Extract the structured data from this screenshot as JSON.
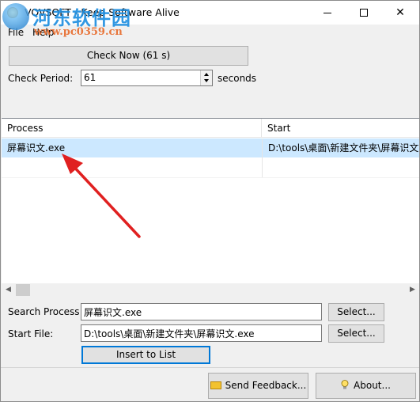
{
  "window": {
    "title": "VOVSOFT - Keep Software Alive",
    "controls": [
      "minimize",
      "maximize",
      "close"
    ]
  },
  "watermark": {
    "site_name": "河东软件园",
    "url": "www.pc0359.cn"
  },
  "menu": {
    "items": [
      {
        "label": "File"
      },
      {
        "label": "Help"
      }
    ]
  },
  "toolbar": {
    "check_now_label": "Check Now (61 s)"
  },
  "check_period": {
    "label": "Check Period:",
    "value": "61",
    "unit": "seconds"
  },
  "process_list": {
    "columns": [
      "Process",
      "Start"
    ],
    "rows": [
      {
        "process": "屏幕识文.exe",
        "start": "D:\\tools\\桌面\\新建文件夹\\屏幕识文.exe"
      }
    ]
  },
  "form": {
    "search_label": "Search Process:",
    "search_value": "屏幕识文.exe",
    "start_label": "Start File:",
    "start_value": "D:\\tools\\桌面\\新建文件夹\\屏幕识文.exe",
    "select_label": "Select...",
    "insert_label": "Insert to List"
  },
  "footer": {
    "feedback_label": "Send Feedback...",
    "about_label": "About..."
  },
  "colors": {
    "selection": "#cce8ff",
    "focus_border": "#0078d7",
    "arrow": "#e02020"
  }
}
